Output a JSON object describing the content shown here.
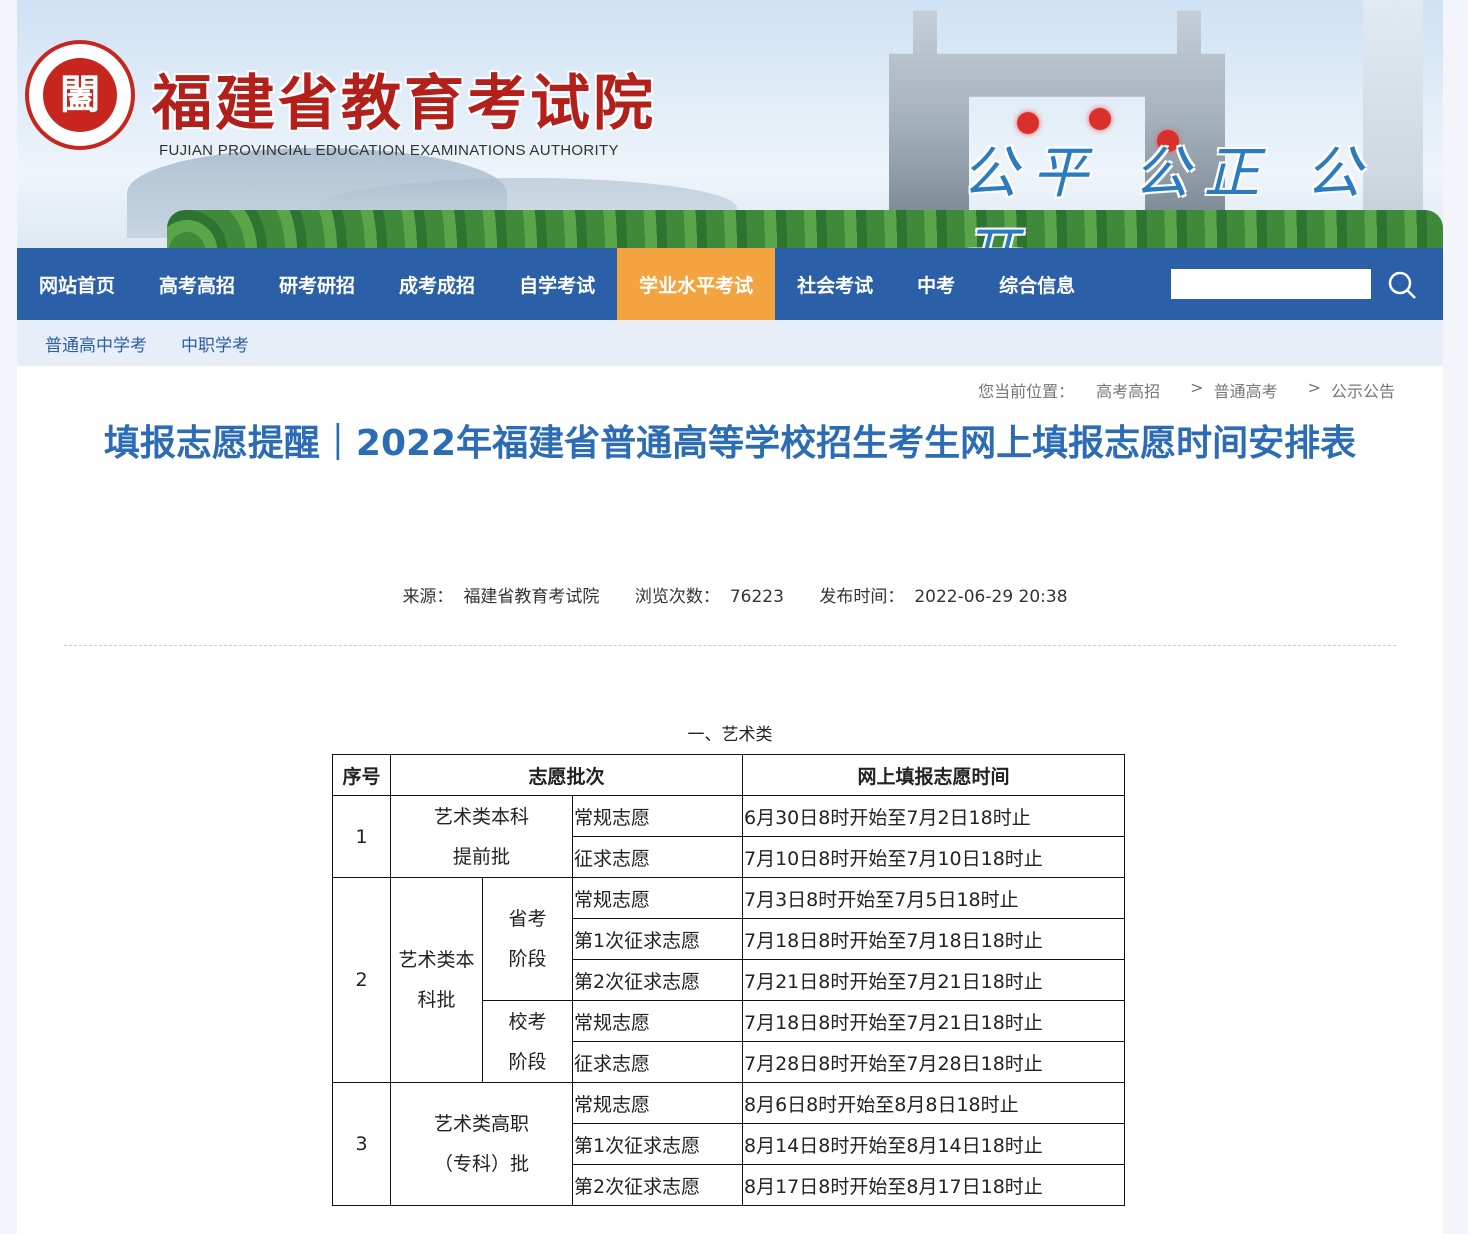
{
  "header": {
    "logo_glyph": "闔",
    "site_title": "福建省教育考试院",
    "site_subtitle": "FUJIAN PROVINCIAL EDUCATION EXAMINATIONS AUTHORITY",
    "slogan": "公平 公正 公开"
  },
  "nav": {
    "items": [
      "网站首页",
      "高考高招",
      "研考研招",
      "成考成招",
      "自学考试",
      "学业水平考试",
      "社会考试",
      "中考",
      "综合信息"
    ],
    "active_index": 5,
    "search_placeholder": ""
  },
  "subnav": {
    "items": [
      "普通高中学考",
      "中职学考"
    ]
  },
  "breadcrumb": {
    "prefix": "您当前位置：",
    "items": [
      "高考高招",
      "普通高考",
      "公示公告"
    ],
    "separator": ">"
  },
  "article": {
    "title": "填报志愿提醒｜2022年福建省普通高等学校招生考生网上填报志愿时间安排表",
    "meta": {
      "source_label": "来源：",
      "source": "福建省教育考试院",
      "views_label": "浏览次数：",
      "views": "76223",
      "date_label": "发布时间：",
      "date": "2022-06-29 20:38"
    },
    "section_title": "一、艺术类"
  },
  "table": {
    "headers": [
      "序号",
      "志愿批次",
      "网上填报志愿时间"
    ],
    "g1": {
      "no": "1",
      "batch_line1": "艺术类本科",
      "batch_line2": "提前批",
      "rows": [
        [
          "常规志愿",
          "6月30日8时开始至7月2日18时止"
        ],
        [
          "征求志愿",
          "7月10日8时开始至7月10日18时止"
        ]
      ]
    },
    "g2": {
      "no": "2",
      "batch_line1": "艺术类本",
      "batch_line2": "科批",
      "stage1_line1": "省考",
      "stage1_line2": "阶段",
      "stage1_rows": [
        [
          "常规志愿",
          "7月3日8时开始至7月5日18时止"
        ],
        [
          "第1次征求志愿",
          "7月18日8时开始至7月18日18时止"
        ],
        [
          "第2次征求志愿",
          "7月21日8时开始至7月21日18时止"
        ]
      ],
      "stage2_line1": "校考",
      "stage2_line2": "阶段",
      "stage2_rows": [
        [
          "常规志愿",
          "7月18日8时开始至7月21日18时止"
        ],
        [
          "征求志愿",
          "7月28日8时开始至7月28日18时止"
        ]
      ]
    },
    "g3": {
      "no": "3",
      "batch_line1": "艺术类高职",
      "batch_line2": "（专科）批",
      "rows": [
        [
          "常规志愿",
          "8月6日8时开始至8月8日18时止"
        ],
        [
          "第1次征求志愿",
          "8月14日8时开始至8月14日18时止"
        ],
        [
          "第2次征求志愿",
          "8月17日8时开始至8月17日18时止"
        ]
      ]
    }
  },
  "colors": {
    "nav_bg": "#2b5fa8",
    "nav_active": "#f3a33f",
    "title_blue": "#2b6cb5",
    "brand_red": "#b3201c",
    "slogan_blue": "#2a7bbf"
  }
}
